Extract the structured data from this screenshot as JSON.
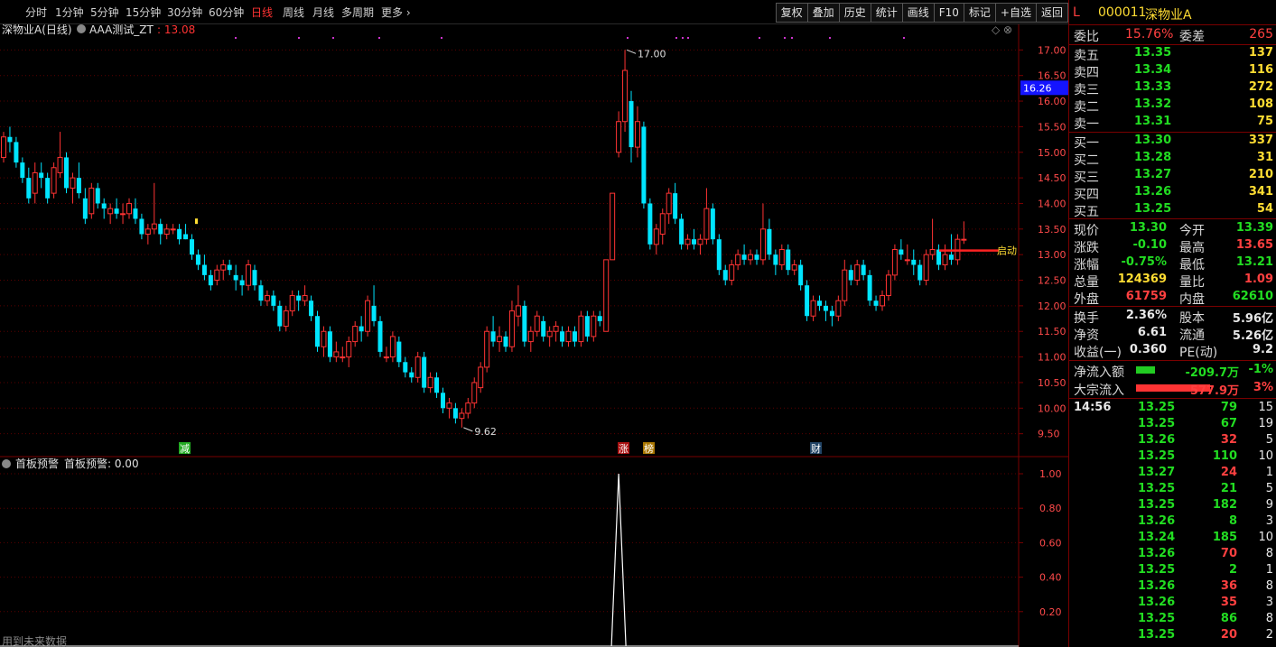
{
  "toolbar": {
    "periods": [
      "分时",
      "1分钟",
      "5分钟",
      "15分钟",
      "30分钟",
      "60分钟",
      "日线",
      "周线",
      "月线",
      "多周期",
      "更多"
    ],
    "active_period": "日线",
    "buttons": [
      "复权",
      "叠加",
      "历史",
      "统计",
      "画线",
      "F10",
      "标记",
      "+自选",
      "返回"
    ]
  },
  "main_chart": {
    "title": "深物业A(日线)",
    "indicator": "AAA测试_ZT",
    "indicator_value": ": 13.08",
    "current_price_tag": "16.26",
    "high_label": "17.00",
    "low_label": "9.62",
    "signal_label": "启动",
    "markers": [
      "减",
      "涨",
      "榜",
      "财"
    ],
    "y_ticks": [
      "17.00",
      "16.50",
      "16.00",
      "15.50",
      "15.00",
      "14.50",
      "14.00",
      "13.50",
      "13.00",
      "12.50",
      "12.00",
      "11.50",
      "11.00",
      "10.50",
      "10.00",
      "9.50"
    ],
    "colors": {
      "up": "#ff3333",
      "down": "#00e5ff",
      "grid": "#5a0000",
      "magenta": "#cc33cc"
    }
  },
  "sub_chart": {
    "title": "首板预警",
    "indicator_label": "首板预警: 0.00",
    "y_ticks": [
      "1.00",
      "0.80",
      "0.60",
      "0.40",
      "0.20"
    ],
    "footer_note": "用到未来数据"
  },
  "chart_data": {
    "type": "candlestick",
    "ylim": [
      9.3,
      17.2
    ],
    "candles": [
      [
        14.9,
        15.4,
        14.8,
        15.3
      ],
      [
        15.3,
        15.5,
        15.0,
        15.2
      ],
      [
        15.2,
        15.3,
        14.7,
        14.8
      ],
      [
        14.8,
        14.9,
        14.4,
        14.5
      ],
      [
        14.5,
        14.7,
        14.0,
        14.1
      ],
      [
        14.2,
        14.8,
        14.0,
        14.6
      ],
      [
        14.6,
        14.8,
        14.3,
        14.5
      ],
      [
        14.5,
        14.6,
        14.0,
        14.1
      ],
      [
        14.2,
        14.8,
        14.1,
        14.7
      ],
      [
        14.6,
        15.4,
        14.5,
        14.9
      ],
      [
        14.9,
        15.0,
        14.2,
        14.3
      ],
      [
        14.3,
        14.6,
        14.0,
        14.5
      ],
      [
        14.5,
        14.8,
        14.1,
        14.2
      ],
      [
        14.1,
        14.3,
        13.6,
        13.7
      ],
      [
        13.8,
        14.4,
        13.7,
        14.3
      ],
      [
        14.3,
        14.4,
        13.9,
        14.0
      ],
      [
        14.0,
        14.1,
        13.7,
        13.9
      ],
      [
        13.8,
        14.0,
        13.6,
        13.9
      ],
      [
        13.9,
        14.1,
        13.7,
        13.8
      ],
      [
        13.8,
        14.0,
        13.6,
        13.8
      ],
      [
        13.8,
        14.1,
        13.7,
        14.0
      ],
      [
        13.9,
        14.1,
        13.6,
        13.7
      ],
      [
        13.7,
        13.8,
        13.3,
        13.4
      ],
      [
        13.4,
        13.6,
        13.2,
        13.5
      ],
      [
        13.5,
        14.4,
        13.4,
        13.6
      ],
      [
        13.6,
        13.7,
        13.2,
        13.4
      ],
      [
        13.4,
        13.6,
        13.3,
        13.5
      ],
      [
        13.5,
        13.6,
        13.4,
        13.5
      ],
      [
        13.5,
        13.6,
        13.2,
        13.3
      ],
      [
        13.4,
        13.6,
        13.3,
        13.3
      ],
      [
        13.3,
        13.4,
        12.9,
        13.0
      ],
      [
        13.0,
        13.1,
        12.7,
        12.8
      ],
      [
        12.8,
        13.0,
        12.5,
        12.6
      ],
      [
        12.6,
        12.7,
        12.3,
        12.4
      ],
      [
        12.5,
        12.8,
        12.4,
        12.7
      ],
      [
        12.7,
        12.9,
        12.5,
        12.8
      ],
      [
        12.8,
        12.9,
        12.6,
        12.7
      ],
      [
        12.6,
        12.8,
        12.3,
        12.5
      ],
      [
        12.5,
        12.6,
        12.2,
        12.4
      ],
      [
        12.4,
        12.9,
        12.3,
        12.8
      ],
      [
        12.7,
        12.8,
        12.3,
        12.4
      ],
      [
        12.4,
        12.5,
        12.0,
        12.1
      ],
      [
        12.1,
        12.3,
        12.0,
        12.2
      ],
      [
        12.2,
        12.3,
        11.9,
        12.0
      ],
      [
        12.0,
        12.1,
        11.5,
        11.6
      ],
      [
        11.6,
        12.0,
        11.5,
        11.9
      ],
      [
        11.9,
        12.3,
        11.8,
        12.2
      ],
      [
        12.2,
        12.3,
        11.9,
        12.1
      ],
      [
        12.1,
        12.4,
        12.0,
        12.2
      ],
      [
        12.1,
        12.2,
        11.7,
        11.8
      ],
      [
        11.8,
        11.9,
        11.1,
        11.2
      ],
      [
        11.2,
        11.6,
        11.0,
        11.5
      ],
      [
        11.5,
        11.6,
        10.9,
        11.0
      ],
      [
        11.0,
        11.3,
        10.9,
        11.1
      ],
      [
        11.0,
        11.2,
        10.9,
        11.0
      ],
      [
        11.0,
        11.4,
        10.8,
        11.3
      ],
      [
        11.3,
        11.7,
        11.2,
        11.6
      ],
      [
        11.6,
        11.8,
        11.3,
        11.5
      ],
      [
        11.5,
        12.2,
        11.4,
        12.1
      ],
      [
        12.0,
        12.4,
        11.6,
        11.7
      ],
      [
        11.7,
        11.8,
        11.0,
        11.1
      ],
      [
        11.0,
        11.2,
        10.9,
        11.0
      ],
      [
        11.0,
        11.5,
        10.9,
        11.4
      ],
      [
        11.3,
        11.4,
        10.8,
        10.9
      ],
      [
        10.9,
        11.0,
        10.6,
        10.7
      ],
      [
        10.7,
        10.8,
        10.5,
        10.6
      ],
      [
        10.6,
        11.1,
        10.5,
        11.0
      ],
      [
        11.0,
        11.1,
        10.3,
        10.4
      ],
      [
        10.4,
        10.7,
        10.3,
        10.6
      ],
      [
        10.6,
        10.7,
        10.2,
        10.3
      ],
      [
        10.3,
        10.4,
        9.9,
        10.0
      ],
      [
        10.0,
        10.2,
        9.8,
        10.1
      ],
      [
        10.0,
        10.1,
        9.7,
        9.8
      ],
      [
        9.8,
        10.0,
        9.62,
        9.9
      ],
      [
        9.9,
        10.2,
        9.8,
        10.1
      ],
      [
        10.1,
        10.6,
        10.0,
        10.5
      ],
      [
        10.4,
        10.9,
        10.3,
        10.8
      ],
      [
        10.8,
        11.6,
        10.7,
        11.5
      ],
      [
        11.5,
        11.8,
        11.2,
        11.3
      ],
      [
        11.3,
        11.6,
        11.1,
        11.4
      ],
      [
        11.4,
        11.5,
        11.1,
        11.2
      ],
      [
        11.2,
        12.1,
        11.1,
        11.9
      ],
      [
        11.8,
        12.4,
        11.6,
        12.0
      ],
      [
        12.0,
        12.1,
        11.2,
        11.3
      ],
      [
        11.3,
        11.6,
        11.1,
        11.5
      ],
      [
        11.5,
        11.9,
        11.4,
        11.8
      ],
      [
        11.7,
        11.8,
        11.3,
        11.4
      ],
      [
        11.4,
        11.6,
        11.2,
        11.5
      ],
      [
        11.5,
        11.7,
        11.3,
        11.6
      ],
      [
        11.5,
        11.6,
        11.2,
        11.3
      ],
      [
        11.3,
        11.6,
        11.2,
        11.5
      ],
      [
        11.5,
        11.6,
        11.2,
        11.3
      ],
      [
        11.3,
        11.9,
        11.2,
        11.8
      ],
      [
        11.8,
        11.9,
        11.3,
        11.4
      ],
      [
        11.4,
        11.9,
        11.3,
        11.8
      ],
      [
        11.8,
        11.9,
        11.6,
        11.7
      ],
      [
        11.5,
        12.9,
        11.6,
        12.9
      ],
      [
        12.9,
        14.2,
        12.9,
        14.2
      ],
      [
        15.0,
        15.8,
        14.9,
        15.6
      ],
      [
        15.6,
        17.0,
        15.4,
        16.6
      ],
      [
        16.0,
        16.2,
        14.8,
        15.1
      ],
      [
        15.1,
        15.9,
        14.9,
        15.6
      ],
      [
        15.5,
        15.6,
        13.9,
        14.0
      ],
      [
        14.0,
        14.1,
        13.1,
        13.2
      ],
      [
        13.2,
        13.6,
        13.0,
        13.5
      ],
      [
        13.4,
        13.9,
        13.2,
        13.8
      ],
      [
        13.8,
        14.3,
        13.6,
        14.2
      ],
      [
        14.2,
        14.4,
        13.6,
        13.7
      ],
      [
        13.7,
        13.8,
        13.1,
        13.2
      ],
      [
        13.2,
        13.4,
        13.1,
        13.3
      ],
      [
        13.3,
        13.5,
        13.1,
        13.2
      ],
      [
        13.2,
        13.4,
        13.0,
        13.3
      ],
      [
        13.3,
        14.3,
        13.2,
        13.9
      ],
      [
        13.9,
        14.0,
        13.2,
        13.3
      ],
      [
        13.3,
        13.4,
        12.6,
        12.7
      ],
      [
        12.7,
        12.8,
        12.4,
        12.5
      ],
      [
        12.5,
        12.9,
        12.4,
        12.8
      ],
      [
        12.8,
        13.1,
        12.7,
        13.0
      ],
      [
        13.0,
        13.2,
        12.8,
        12.9
      ],
      [
        12.9,
        13.1,
        12.8,
        13.0
      ],
      [
        13.0,
        13.1,
        12.8,
        12.9
      ],
      [
        12.9,
        14.0,
        12.8,
        13.5
      ],
      [
        13.5,
        13.7,
        12.9,
        13.0
      ],
      [
        13.0,
        13.1,
        12.6,
        12.8
      ],
      [
        12.8,
        13.2,
        12.7,
        13.1
      ],
      [
        13.1,
        13.2,
        12.6,
        12.7
      ],
      [
        12.7,
        12.9,
        12.6,
        12.8
      ],
      [
        12.8,
        12.9,
        12.3,
        12.4
      ],
      [
        12.4,
        12.5,
        11.7,
        11.8
      ],
      [
        11.8,
        12.2,
        11.7,
        12.1
      ],
      [
        12.1,
        12.2,
        11.9,
        12.0
      ],
      [
        12.0,
        12.1,
        11.7,
        11.9
      ],
      [
        11.9,
        12.0,
        11.6,
        11.8
      ],
      [
        11.8,
        12.2,
        11.7,
        12.1
      ],
      [
        12.1,
        12.9,
        12.0,
        12.7
      ],
      [
        12.7,
        12.8,
        12.4,
        12.5
      ],
      [
        12.5,
        12.9,
        12.4,
        12.8
      ],
      [
        12.8,
        12.9,
        12.5,
        12.6
      ],
      [
        12.6,
        12.7,
        12.0,
        12.1
      ],
      [
        12.1,
        12.2,
        11.9,
        12.0
      ],
      [
        12.0,
        12.3,
        11.9,
        12.2
      ],
      [
        12.2,
        12.7,
        12.1,
        12.6
      ],
      [
        12.6,
        13.2,
        12.5,
        13.1
      ],
      [
        13.1,
        13.3,
        12.9,
        13.0
      ],
      [
        12.9,
        13.2,
        12.8,
        12.9
      ],
      [
        12.9,
        13.1,
        12.6,
        12.8
      ],
      [
        12.8,
        12.9,
        12.4,
        12.5
      ],
      [
        12.5,
        13.1,
        12.4,
        13.0
      ],
      [
        13.0,
        13.7,
        12.9,
        13.1
      ],
      [
        13.1,
        13.2,
        12.7,
        12.8
      ],
      [
        12.8,
        13.2,
        12.7,
        13.0
      ],
      [
        13.0,
        13.4,
        12.8,
        12.9
      ],
      [
        12.9,
        13.4,
        12.8,
        13.3
      ],
      [
        13.3,
        13.65,
        13.21,
        13.3
      ]
    ],
    "sub_series": {
      "name": "首板预警",
      "spike_index": 98,
      "spike_value": 1.0
    }
  },
  "quote": {
    "market_tag": "L",
    "code": "000011",
    "name": "深物业A",
    "weibi_label": "委比",
    "weibi": "15.76%",
    "weicha_label": "委差",
    "weicha": "265",
    "asks": [
      {
        "label": "卖五",
        "price": "13.35",
        "vol": "137"
      },
      {
        "label": "卖四",
        "price": "13.34",
        "vol": "116"
      },
      {
        "label": "卖三",
        "price": "13.33",
        "vol": "272"
      },
      {
        "label": "卖二",
        "price": "13.32",
        "vol": "108"
      },
      {
        "label": "卖一",
        "price": "13.31",
        "vol": "75"
      }
    ],
    "bids": [
      {
        "label": "买一",
        "price": "13.30",
        "vol": "337"
      },
      {
        "label": "买二",
        "price": "13.28",
        "vol": "31"
      },
      {
        "label": "买三",
        "price": "13.27",
        "vol": "210"
      },
      {
        "label": "买四",
        "price": "13.26",
        "vol": "341"
      },
      {
        "label": "买五",
        "price": "13.25",
        "vol": "54"
      }
    ],
    "stats": [
      {
        "l1": "现价",
        "v1": "13.30",
        "c1": "dn",
        "l2": "今开",
        "v2": "13.39",
        "c2": "dn"
      },
      {
        "l1": "涨跌",
        "v1": "-0.10",
        "c1": "dn",
        "l2": "最高",
        "v2": "13.65",
        "c2": "up"
      },
      {
        "l1": "涨幅",
        "v1": "-0.75%",
        "c1": "dn",
        "l2": "最低",
        "v2": "13.21",
        "c2": "dn"
      },
      {
        "l1": "总量",
        "v1": "124369",
        "c1": "yl",
        "l2": "量比",
        "v2": "1.09",
        "c2": "up"
      },
      {
        "l1": "外盘",
        "v1": "61759",
        "c1": "up",
        "l2": "内盘",
        "v2": "62610",
        "c2": "dn"
      }
    ],
    "stats2": [
      {
        "l1": "换手",
        "v1": "2.36%",
        "l2": "股本",
        "v2": "5.96亿"
      },
      {
        "l1": "净资",
        "v1": "6.61",
        "l2": "流通",
        "v2": "5.26亿"
      },
      {
        "l1": "收益(一)",
        "v1": "0.360",
        "l2": "PE(动)",
        "v2": "9.2"
      }
    ],
    "flows": [
      {
        "label": "净流入额",
        "value": "-209.7万",
        "pct": "-1%",
        "bar_fraction": 0.25,
        "bar_color": "#22cc22",
        "vcls": "dn",
        "pcls": "dn"
      },
      {
        "label": "大宗流入",
        "value": "577.9万",
        "pct": "3%",
        "bar_fraction": 1.0,
        "bar_color": "#ff3333",
        "vcls": "up",
        "pcls": "up"
      }
    ],
    "ticks_time": "14:56",
    "ticks": [
      {
        "p": "13.25",
        "v": "79",
        "n": "15",
        "c": "dn"
      },
      {
        "p": "13.25",
        "v": "67",
        "n": "19",
        "c": "dn"
      },
      {
        "p": "13.26",
        "v": "32",
        "n": "5",
        "c": "up"
      },
      {
        "p": "13.25",
        "v": "110",
        "n": "10",
        "c": "dn"
      },
      {
        "p": "13.27",
        "v": "24",
        "n": "1",
        "c": "up"
      },
      {
        "p": "13.25",
        "v": "21",
        "n": "5",
        "c": "dn"
      },
      {
        "p": "13.25",
        "v": "182",
        "n": "9",
        "c": "dn"
      },
      {
        "p": "13.26",
        "v": "8",
        "n": "3",
        "c": "dn"
      },
      {
        "p": "13.24",
        "v": "185",
        "n": "10",
        "c": "dn"
      },
      {
        "p": "13.26",
        "v": "70",
        "n": "8",
        "c": "up"
      },
      {
        "p": "13.25",
        "v": "2",
        "n": "1",
        "c": "dn"
      },
      {
        "p": "13.26",
        "v": "36",
        "n": "8",
        "c": "up"
      },
      {
        "p": "13.26",
        "v": "35",
        "n": "3",
        "c": "up"
      },
      {
        "p": "13.25",
        "v": "86",
        "n": "8",
        "c": "dn"
      },
      {
        "p": "13.25",
        "v": "20",
        "n": "2",
        "c": "up"
      }
    ]
  }
}
